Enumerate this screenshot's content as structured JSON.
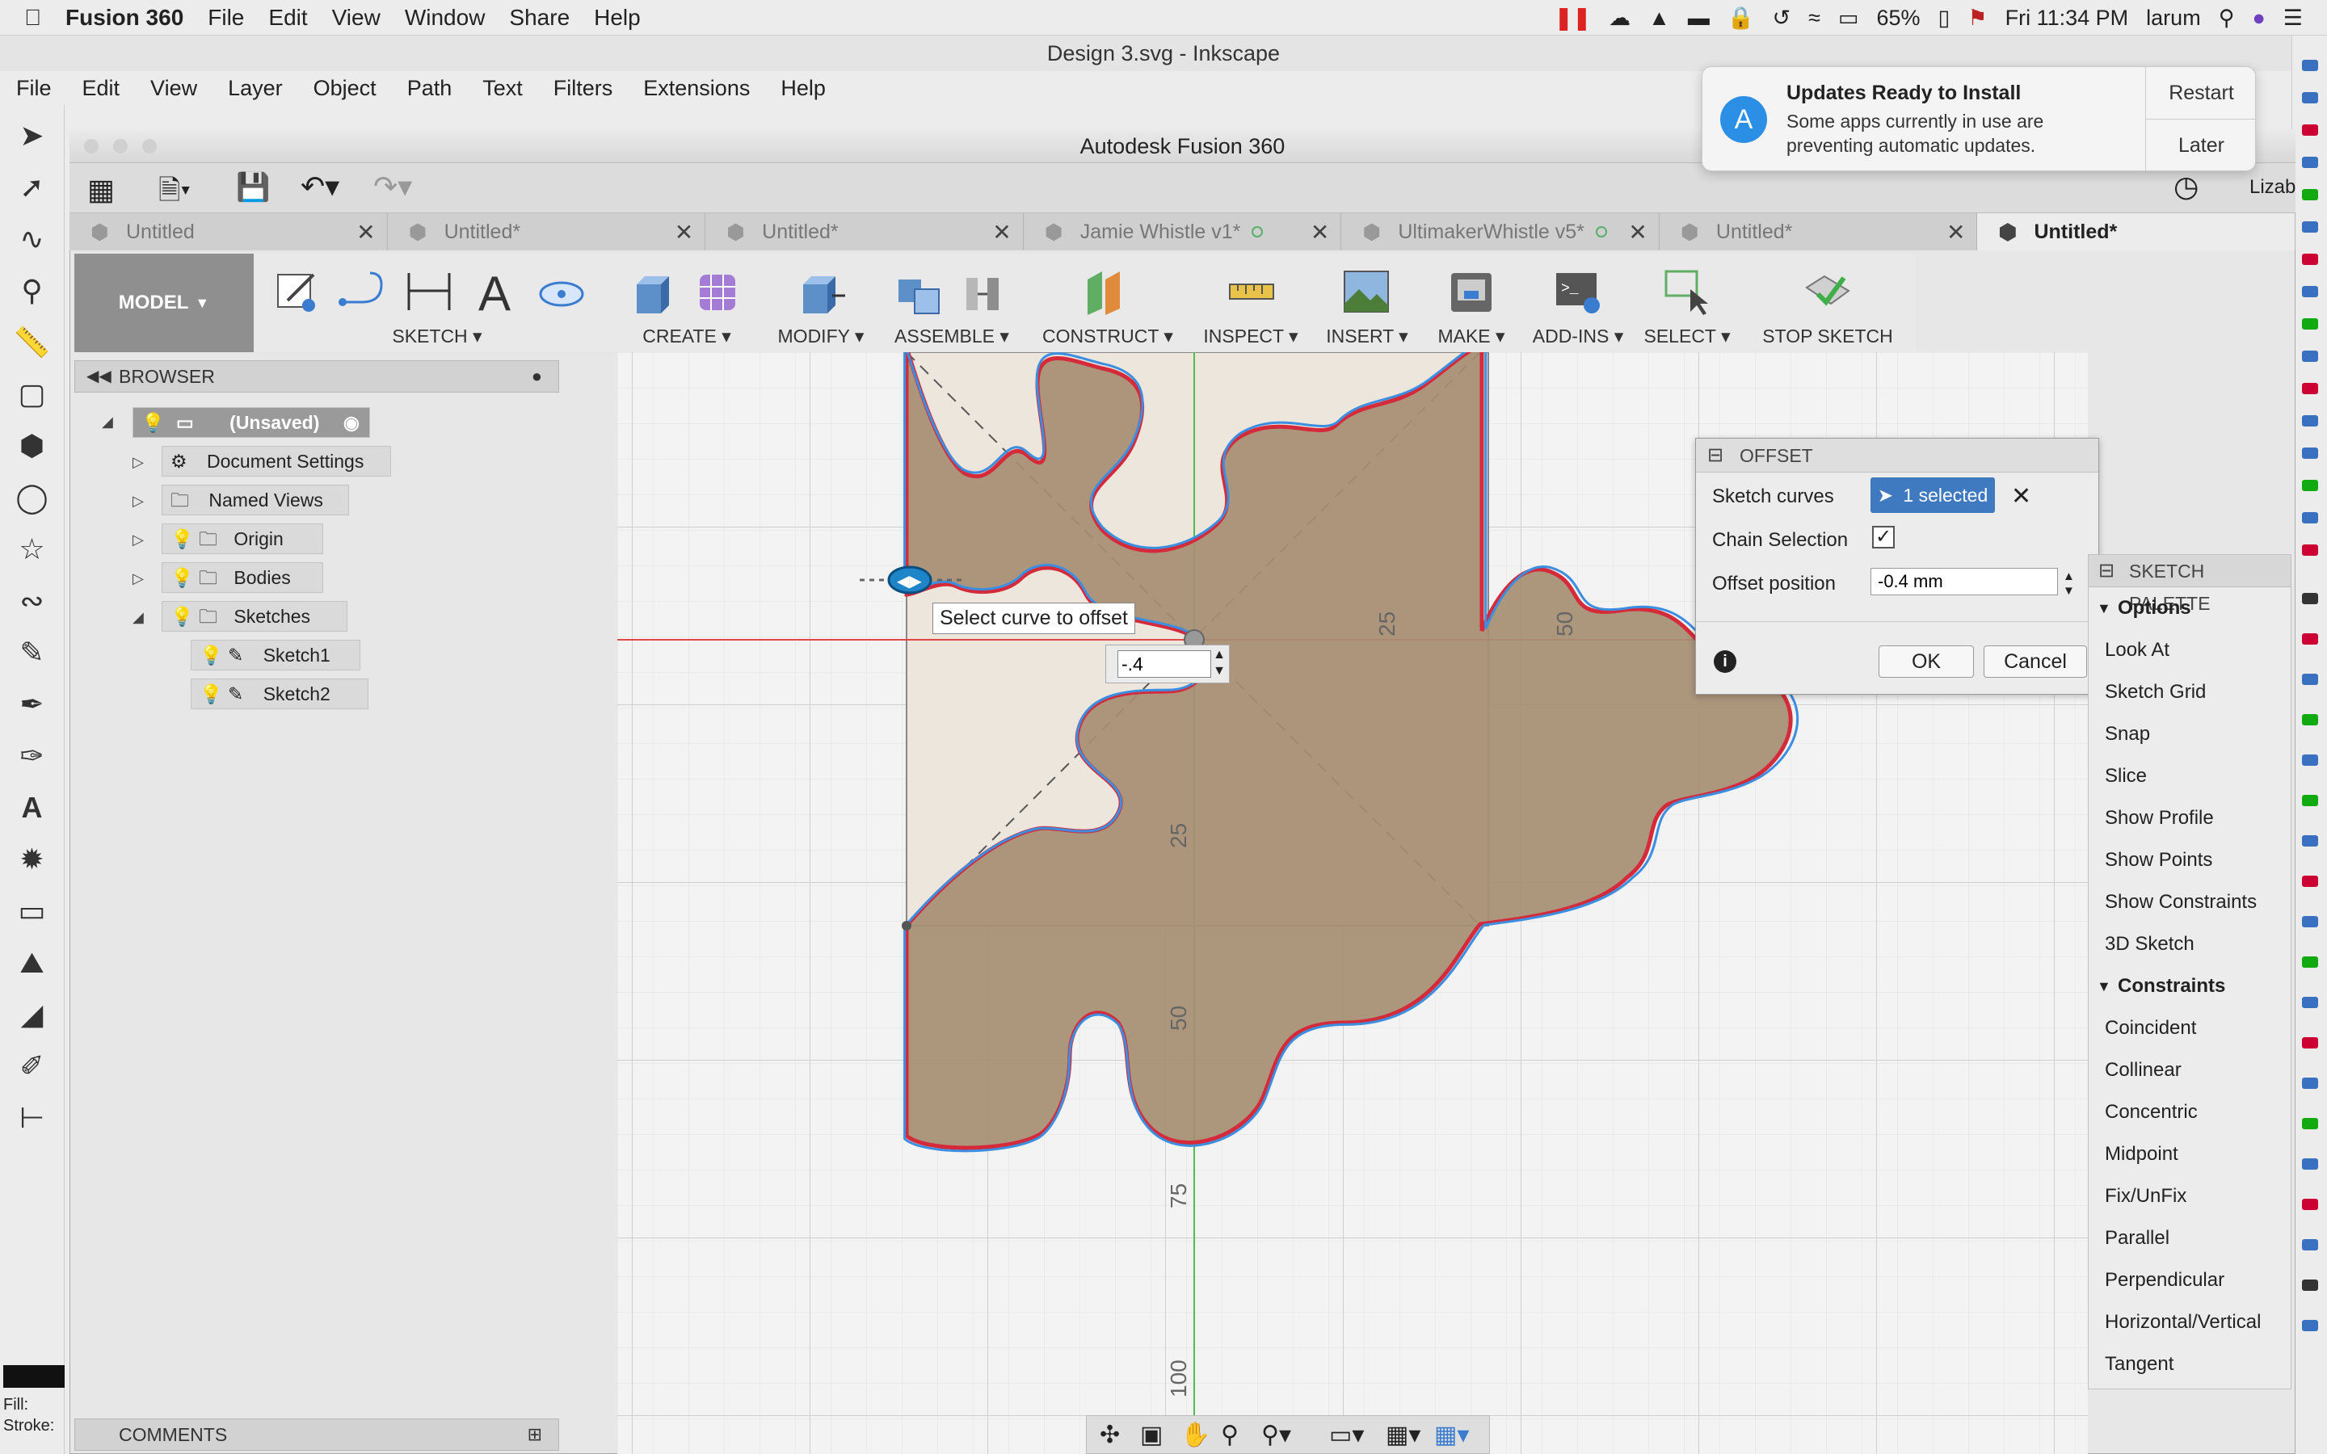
{
  "mac_menu": {
    "app": "Fusion 360",
    "items": [
      "File",
      "Edit",
      "View",
      "Window",
      "Share",
      "Help"
    ],
    "battery": "65%",
    "clock": "Fri 11:34 PM",
    "user": "larum"
  },
  "inkscape": {
    "title": "Design 3.svg - Inkscape",
    "menu": [
      "File",
      "Edit",
      "View",
      "Layer",
      "Object",
      "Path",
      "Text",
      "Filters",
      "Extensions",
      "Help"
    ],
    "fill_label": "Fill:",
    "stroke_label": "Stroke:"
  },
  "fusion": {
    "title": "Autodesk Fusion 360",
    "user_short": "Lizab",
    "tabs": [
      {
        "label": "Untitled",
        "active": false,
        "saved_dot": false
      },
      {
        "label": "Untitled*",
        "active": false,
        "saved_dot": false
      },
      {
        "label": "Untitled*",
        "active": false,
        "saved_dot": false
      },
      {
        "label": "Jamie Whistle v1*",
        "active": false,
        "saved_dot": true
      },
      {
        "label": "UltimakerWhistle v5*",
        "active": false,
        "saved_dot": true
      },
      {
        "label": "Untitled*",
        "active": false,
        "saved_dot": false
      },
      {
        "label": "Untitled*",
        "active": true,
        "saved_dot": false
      }
    ],
    "ribbon": {
      "workspace": "MODEL",
      "groups": [
        "SKETCH",
        "CREATE",
        "MODIFY",
        "ASSEMBLE",
        "CONSTRUCT",
        "INSPECT",
        "INSERT",
        "MAKE",
        "ADD-INS",
        "SELECT",
        "STOP SKETCH"
      ]
    },
    "browser": {
      "title": "BROWSER",
      "root": "(Unsaved)",
      "items": [
        "Document Settings",
        "Named Views",
        "Origin",
        "Bodies",
        "Sketches"
      ],
      "sketches": [
        "Sketch1",
        "Sketch2"
      ]
    },
    "comments": "COMMENTS",
    "canvas": {
      "tooltip": "Select curve to offset",
      "offset_input": "-.4",
      "axis_labels": [
        "25",
        "50",
        "25",
        "50",
        "75",
        "100"
      ]
    },
    "offset_dialog": {
      "title": "OFFSET",
      "sketch_curves_label": "Sketch curves",
      "sketch_curves_value": "1 selected",
      "chain_selection_label": "Chain Selection",
      "chain_selection_checked": true,
      "offset_position_label": "Offset position",
      "offset_position_value": "-0.4 mm",
      "ok": "OK",
      "cancel": "Cancel"
    },
    "sketch_palette": {
      "title": "SKETCH PALETTE",
      "options_header": "Options",
      "options": [
        "Look At",
        "Sketch Grid",
        "Snap",
        "Slice",
        "Show Profile",
        "Show Points",
        "Show Constraints",
        "3D Sketch"
      ],
      "constraints_header": "Constraints",
      "constraints": [
        "Coincident",
        "Collinear",
        "Concentric",
        "Midpoint",
        "Fix/UnFix",
        "Parallel",
        "Perpendicular",
        "Horizontal/Vertical",
        "Tangent"
      ]
    }
  },
  "notification": {
    "title": "Updates Ready to Install",
    "body": "Some apps currently in use are preventing automatic updates.",
    "restart": "Restart",
    "later": "Later"
  }
}
